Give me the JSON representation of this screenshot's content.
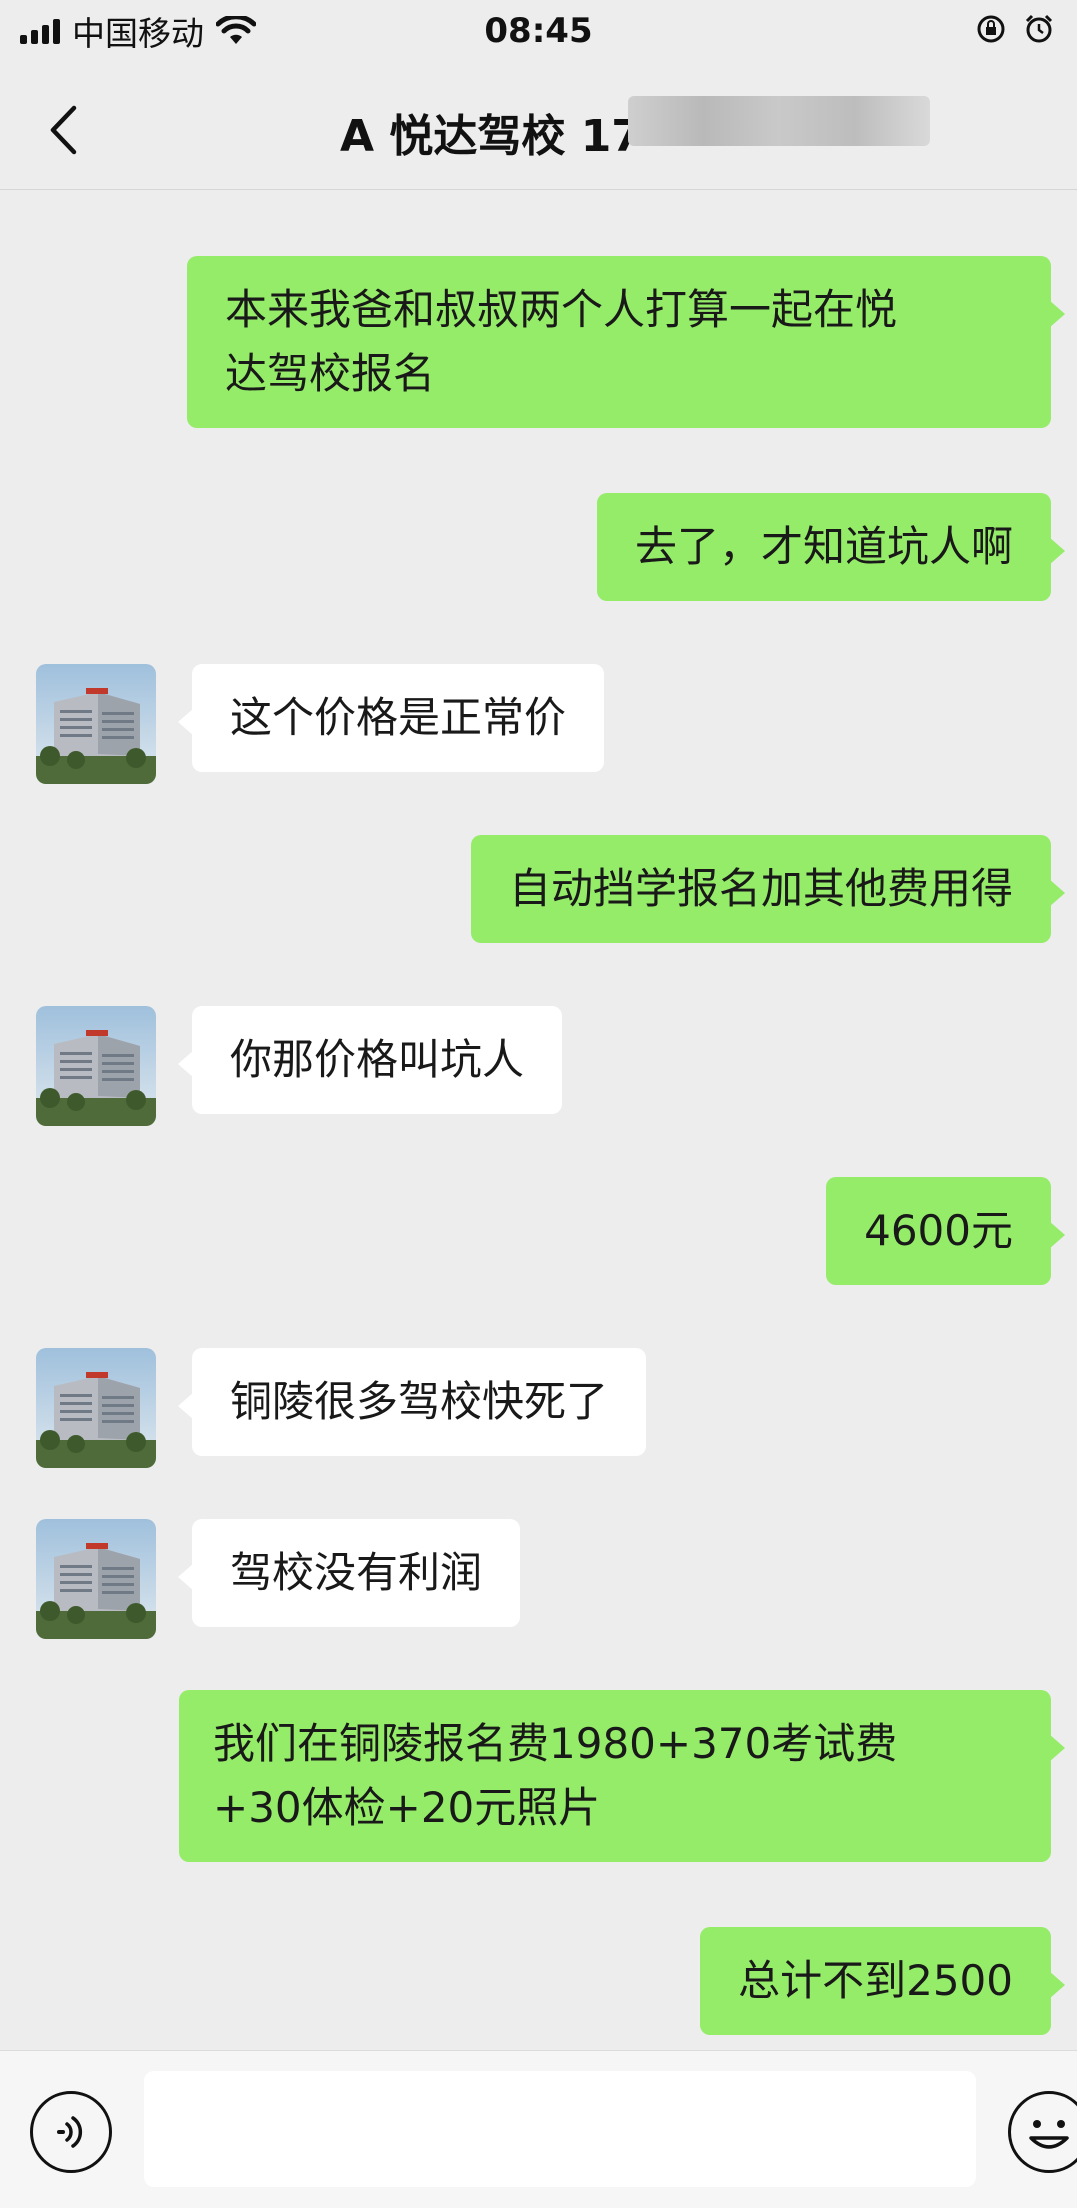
{
  "status_bar": {
    "carrier": "中国移动",
    "time": "08:45"
  },
  "header": {
    "title": "A 悦达驾校 17"
  },
  "messages": [
    {
      "side": "out",
      "text_lines": [
        "本来我爸和叔叔两个人打算一起在悦",
        "达驾校报名"
      ]
    },
    {
      "side": "out",
      "text_lines": [
        "去了，才知道坑人啊"
      ]
    },
    {
      "side": "in",
      "text_lines": [
        "这个价格是正常价"
      ]
    },
    {
      "side": "out",
      "text_lines": [
        "自动挡学报名加其他费用得"
      ]
    },
    {
      "side": "in",
      "text_lines": [
        "你那价格叫坑人"
      ]
    },
    {
      "side": "out",
      "text_lines": [
        "4600元"
      ]
    },
    {
      "side": "in",
      "text_lines": [
        "铜陵很多驾校快死了"
      ]
    },
    {
      "side": "in",
      "text_lines": [
        "驾校没有利润"
      ]
    },
    {
      "side": "out",
      "text_lines": [
        "我们在铜陵报名费1980+370考试费",
        "+30体检+20元照片"
      ]
    },
    {
      "side": "out",
      "text_lines": [
        "总计不到2500"
      ]
    }
  ],
  "input_bar": {
    "voice_icon": "voice-icon",
    "emoji_icon": "emoji-icon",
    "text_value": ""
  },
  "colors": {
    "background": "#ededed",
    "outgoing_bubble": "#95ec69",
    "incoming_bubble": "#ffffff"
  }
}
